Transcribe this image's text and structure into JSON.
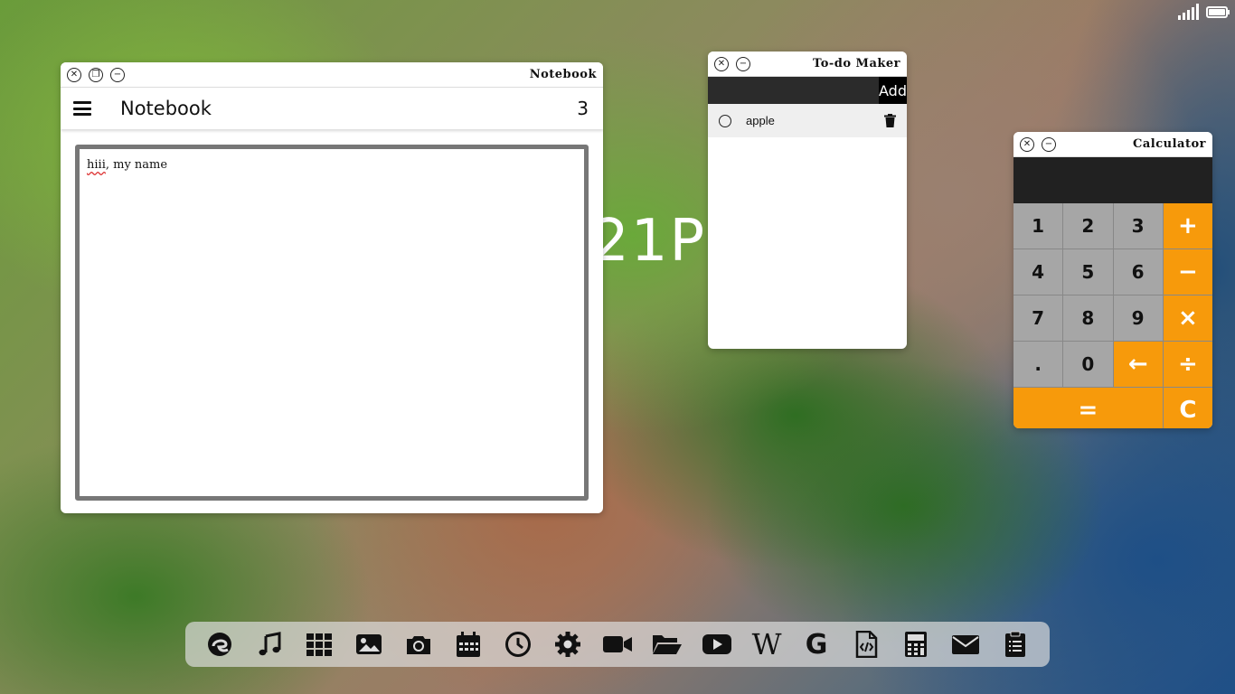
{
  "clock": {
    "text": "21P"
  },
  "notebook": {
    "title": "Notebook",
    "header_title": "Notebook",
    "count": "3",
    "content_misspelled": "hiii",
    "content_rest": ", my name"
  },
  "todo": {
    "title": "To-do Maker",
    "input_value": "",
    "add_label": "Add",
    "items": [
      {
        "text": "apple"
      }
    ]
  },
  "calculator": {
    "title": "Calculator",
    "display": "",
    "keys": [
      "1",
      "2",
      "3",
      "+",
      "4",
      "5",
      "6",
      "−",
      "7",
      "8",
      "9",
      "×",
      ".",
      "0",
      "←",
      "÷",
      "=",
      "C"
    ]
  },
  "dock": {
    "icons": [
      "edge-icon",
      "music-icon",
      "apps-grid-icon",
      "image-icon",
      "camera-icon",
      "calendar-icon",
      "clock-icon",
      "settings-gear-icon",
      "video-camera-icon",
      "folder-icon",
      "youtube-icon",
      "wikipedia-icon",
      "google-icon",
      "code-file-icon",
      "calculator-icon",
      "mail-icon",
      "clipboard-icon"
    ],
    "wikipedia_glyph": "W",
    "google_glyph": "G"
  },
  "colors": {
    "accent_orange": "#f79a0b",
    "calc_key_gray": "#a6a6a6",
    "dark_bar": "#2b2b2b"
  }
}
